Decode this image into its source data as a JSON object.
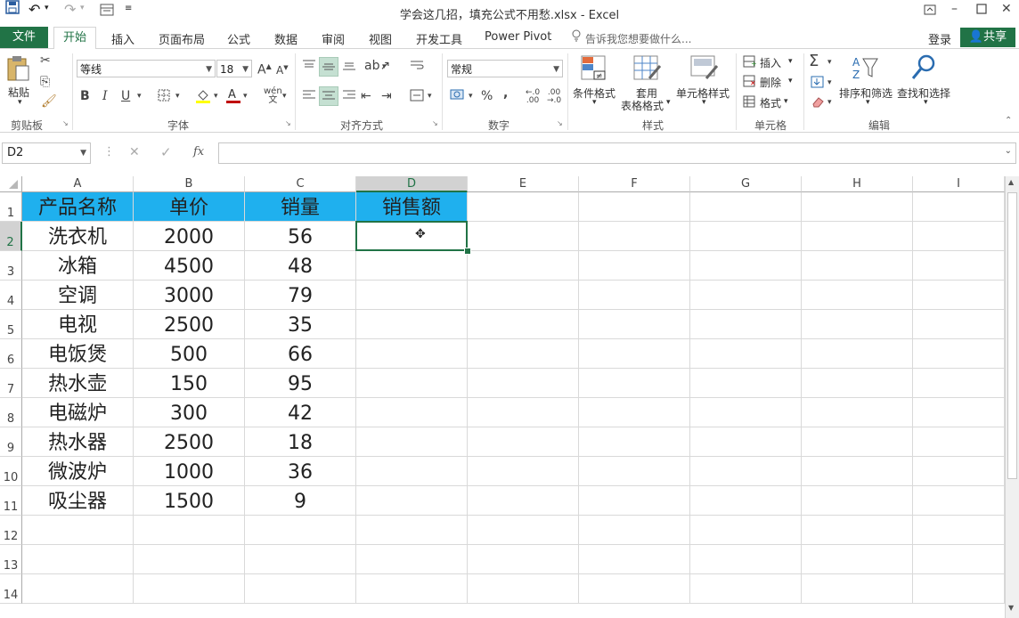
{
  "window": {
    "title": "学会这几招，填充公式不用愁.xlsx - Excel"
  },
  "tabs": {
    "file": "文件",
    "items": [
      "开始",
      "插入",
      "页面布局",
      "公式",
      "数据",
      "审阅",
      "视图",
      "开发工具",
      "Power Pivot"
    ],
    "tell_me": "告诉我您想要做什么...",
    "login": "登录",
    "share": "共享"
  },
  "ribbon": {
    "clipboard": {
      "paste": "粘贴",
      "label": "剪贴板"
    },
    "font": {
      "name": "等线",
      "size": "18",
      "bold": "B",
      "italic": "I",
      "underline": "U",
      "label": "字体"
    },
    "alignment": {
      "label": "对齐方式"
    },
    "number": {
      "format": "常规",
      "percent": "%",
      "comma": ",",
      "label": "数字"
    },
    "styles": {
      "conditional": "条件格式",
      "table_line1": "套用",
      "table_line2": "表格格式",
      "cell_styles": "单元格样式",
      "label": "样式"
    },
    "cells": {
      "insert": "插入",
      "delete": "删除",
      "format": "格式",
      "label": "单元格"
    },
    "editing": {
      "sum": "Σ",
      "sort": "排序和筛选",
      "find": "查找和选择",
      "label": "编辑"
    }
  },
  "formula_bar": {
    "name_box": "D2",
    "fx": "fx",
    "value": ""
  },
  "sheet": {
    "columns": [
      "A",
      "B",
      "C",
      "D",
      "E",
      "F",
      "G",
      "H",
      "I"
    ],
    "rows": [
      "1",
      "2",
      "3",
      "4",
      "5",
      "6",
      "7",
      "8",
      "9",
      "10",
      "11",
      "12",
      "13",
      "14"
    ],
    "header": [
      "产品名称",
      "单价",
      "销量",
      "销售额"
    ],
    "data": [
      [
        "洗衣机",
        "2000",
        "56"
      ],
      [
        "冰箱",
        "4500",
        "48"
      ],
      [
        "空调",
        "3000",
        "79"
      ],
      [
        "电视",
        "2500",
        "35"
      ],
      [
        "电饭煲",
        "500",
        "66"
      ],
      [
        "热水壶",
        "150",
        "95"
      ],
      [
        "电磁炉",
        "300",
        "42"
      ],
      [
        "热水器",
        "2500",
        "18"
      ],
      [
        "微波炉",
        "1000",
        "36"
      ],
      [
        "吸尘器",
        "1500",
        "9"
      ]
    ],
    "active_cell": "D2",
    "colors": {
      "header_fill": "#1fb0ee",
      "accent": "#217346",
      "selection": "#217346"
    }
  }
}
